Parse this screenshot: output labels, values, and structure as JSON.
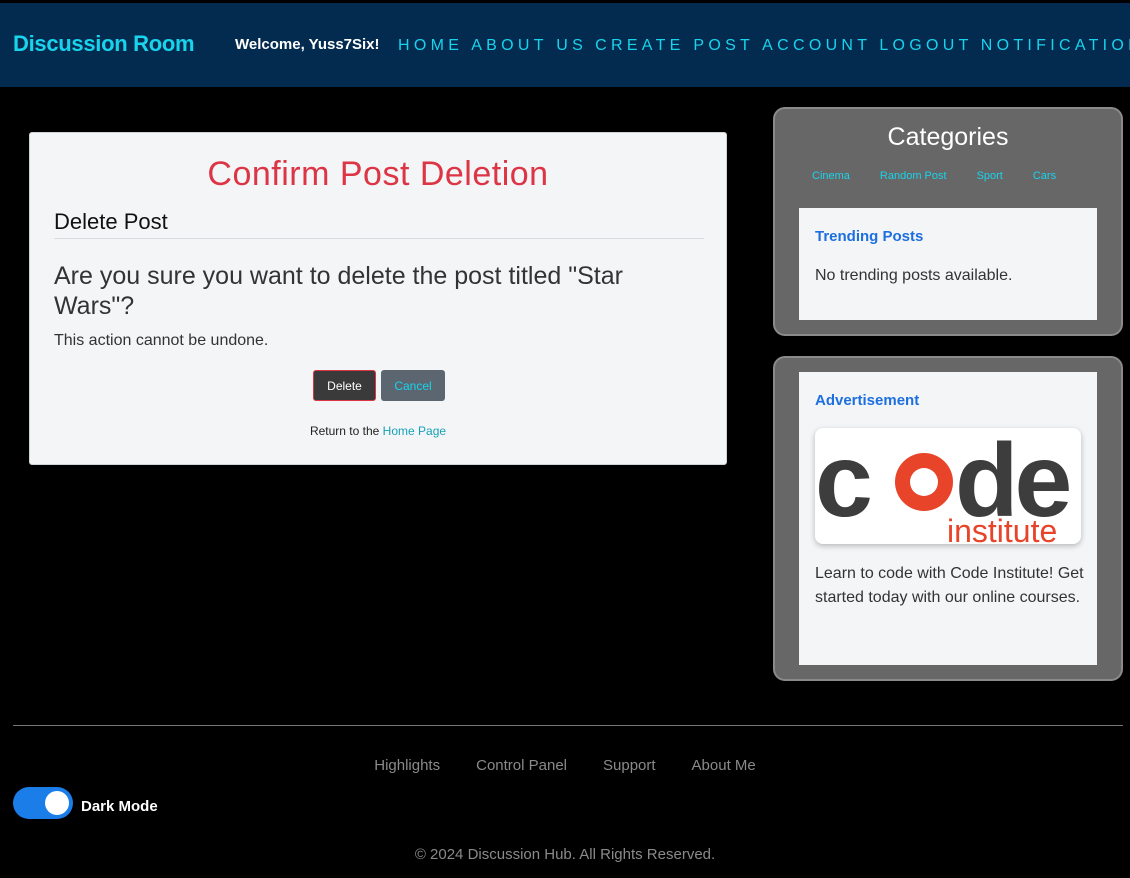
{
  "nav": {
    "brand": "Discussion Room",
    "welcome": "Welcome, Yuss7Six!",
    "links": [
      "HOME",
      "ABOUT US",
      "CREATE POST",
      "ACCOUNT",
      "LOGOUT",
      "NOTIFICATIONS"
    ]
  },
  "main": {
    "title": "Confirm Post Deletion",
    "subtitle": "Delete Post",
    "question": "Are you sure you want to delete the post titled \"Star Wars\"?",
    "warning": "This action cannot be undone.",
    "delete_label": "Delete",
    "cancel_label": "Cancel",
    "return_prefix": "Return to the",
    "return_link": "Home Page"
  },
  "sidebar": {
    "categories_title": "Categories",
    "categories": [
      "Cinema",
      "Random Post",
      "Sport",
      "Cars"
    ],
    "trending_title": "Trending Posts",
    "trending_empty": "No trending posts available.",
    "ad_title": "Advertisement",
    "ad_logo_word": "code",
    "ad_logo_sub": "institute",
    "ad_text": "Learn to code with Code Institute! Get started today with our online courses."
  },
  "footer": {
    "links": [
      "Highlights",
      "Control Panel",
      "Support",
      "About Me"
    ],
    "dark_mode_label": "Dark Mode",
    "dark_mode_on": true,
    "copyright": "© 2024 Discussion Hub. All Rights Reserved."
  },
  "colors": {
    "nav_bg": "#032b50",
    "accent_cyan": "#19d3ec",
    "danger": "#dc3545",
    "link_blue": "#1d6fe0",
    "toggle_blue": "#1a7de8"
  }
}
